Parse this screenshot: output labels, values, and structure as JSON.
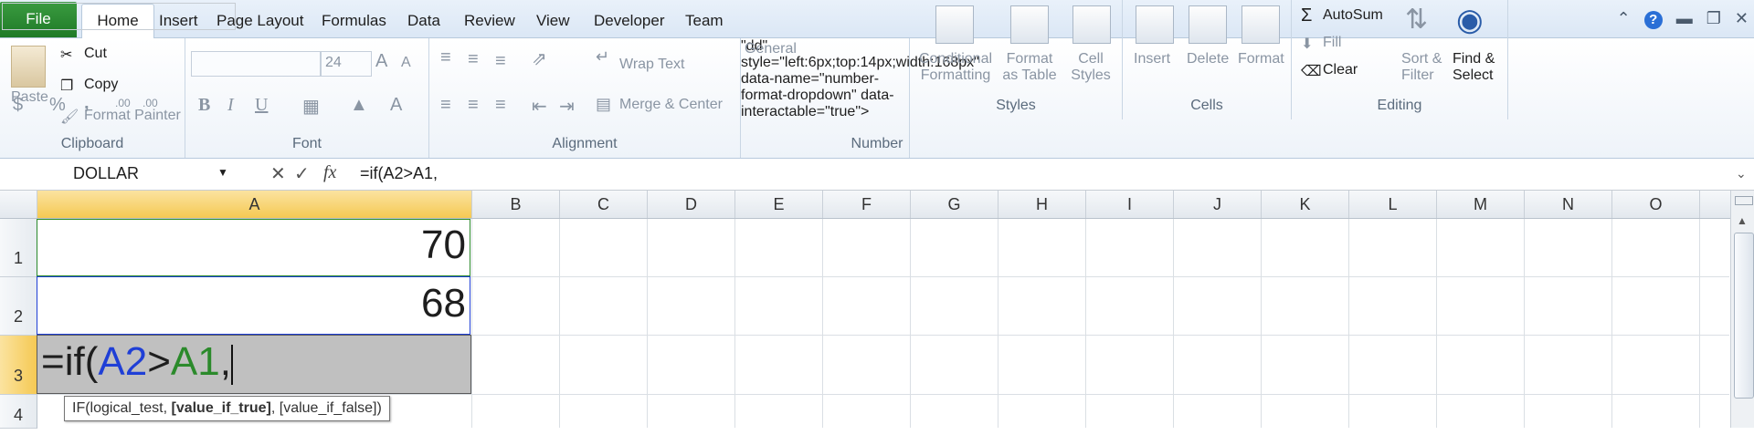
{
  "tabs": {
    "file": "File",
    "items": [
      "Home",
      "Insert",
      "Page Layout",
      "Formulas",
      "Data",
      "Review",
      "View",
      "Developer",
      "Team"
    ]
  },
  "ribbon": {
    "clipboard": {
      "label": "Clipboard",
      "paste": "Paste",
      "cut": "Cut",
      "copy": "Copy",
      "format_painter": "Format Painter"
    },
    "font": {
      "label": "Font",
      "size": "24",
      "bold": "B",
      "italic": "I",
      "underline": "U",
      "grow": "A",
      "shrink": "A",
      "color": "A"
    },
    "alignment": {
      "label": "Alignment",
      "wrap": "Wrap Text",
      "merge": "Merge & Center"
    },
    "number": {
      "label": "Number",
      "format": "General",
      "currency": "$",
      "percent": "%",
      "comma": ",",
      "inc": ".00",
      "dec": ".00"
    },
    "styles": {
      "label": "Styles",
      "conditional": [
        "Conditional",
        "Formatting"
      ],
      "format_table": [
        "Format",
        "as Table"
      ],
      "cell_styles": [
        "Cell",
        "Styles"
      ]
    },
    "cells": {
      "label": "Cells",
      "insert": "Insert",
      "delete": "Delete",
      "format": "Format"
    },
    "editing": {
      "label": "Editing",
      "autosum": "AutoSum",
      "fill": "Fill",
      "clear": "Clear",
      "sort": [
        "Sort &",
        "Filter"
      ],
      "find": [
        "Find &",
        "Select"
      ]
    }
  },
  "formula_bar": {
    "name_box": "DOLLAR",
    "fx": "fx",
    "formula": "=if(A2>A1,"
  },
  "columns": [
    "A",
    "B",
    "C",
    "D",
    "E",
    "F",
    "G",
    "H",
    "I",
    "J",
    "K",
    "L",
    "M",
    "N",
    "O"
  ],
  "rows": [
    "1",
    "2",
    "3",
    "4"
  ],
  "cells": {
    "A1": "70",
    "A2": "68",
    "A3_parts": [
      "=if(",
      "A2",
      ">",
      "A1",
      ","
    ]
  },
  "tooltip": {
    "pre": "IF(logical_test, ",
    "bold": "[value_if_true]",
    "post": ", [value_if_false])"
  },
  "colors": {
    "file_tab": "#2a8a31",
    "a2_ref": "#1f3fd6",
    "a1_ref": "#2b8a2b",
    "active_cell": "#c0c0c0",
    "selected_header": "#f7d36b"
  }
}
